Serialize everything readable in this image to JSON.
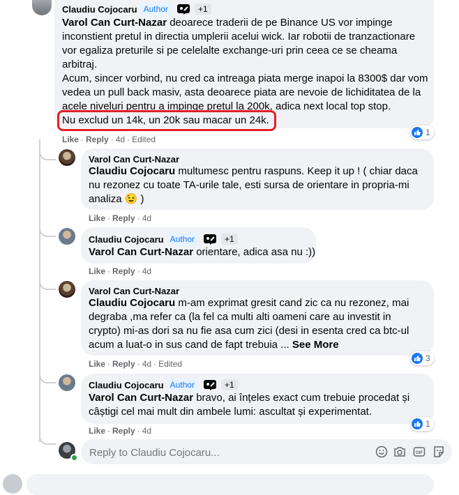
{
  "main_comment": {
    "author": "Claudiu Cojocaru",
    "author_badge": "Author",
    "plus_badge": "+1",
    "mention": "Varol Can Curt-Nazar",
    "p1_rest": " deoarece traderii de pe Binance US vor impinge inconstient pretul in directia umplerii acelui wick. Iar robotii de tranzactionare vor egaliza preturile si pe celelalte exchange-uri prin ceea ce se cheama arbitraj.",
    "p2": "Acum, sincer vorbind, nu cred ca intreaga piata merge inapoi la 8300$ dar vom vedea un pull back masiv, asta deoarece piata are nevoie de lichiditatea de la acele niveluri pentru a impinge pretul la 200k, adica next local top stop.",
    "p3": "Nu exclud un 14k, un 20k sau macar un 24k.",
    "like": "Like",
    "reply": "Reply",
    "time": "4d",
    "edited": "Edited",
    "reactions": "1"
  },
  "replies": [
    {
      "author": "Varol Can Curt-Nazar",
      "mention": "Claudiu Cojocaru",
      "text": " multumesc pentru raspuns. Keep it up ! ( chiar daca nu rezonez cu toate TA-urile tale, esti sursa de orientare in propria-mi analiza ",
      "emoji": "😉",
      "text_end": " )",
      "like": "Like",
      "reply": "Reply",
      "time": "4d"
    },
    {
      "author": "Claudiu Cojocaru",
      "author_badge": "Author",
      "plus_badge": "+1",
      "mention": "Varol Can Curt-Nazar",
      "text": " orientare, adica asa nu :))",
      "like": "Like",
      "reply": "Reply",
      "time": "4d"
    },
    {
      "author": "Varol Can Curt-Nazar",
      "mention": "Claudiu Cojocaru",
      "text": " m-am exprimat gresit cand zic ca nu rezonez, mai degraba ,ma refer ca (la fel ca multi alti oameni care au investit in crypto) mi-as dori sa nu fie asa cum zici (desi in esenta cred ca btc-ul acum a luat-o in sus cand de fapt trebuia ... ",
      "see_more": "See More",
      "like": "Like",
      "reply": "Reply",
      "time": "4d",
      "edited": "Edited",
      "reactions": "3"
    },
    {
      "author": "Claudiu Cojocaru",
      "author_badge": "Author",
      "plus_badge": "+1",
      "mention": "Varol Can Curt-Nazar",
      "text": " bravo, ai înțeles exact cum trebuie procedat și câștigi cel mai mult din ambele lumi: ascultat și experimentat.",
      "like": "Like",
      "reply": "Reply",
      "time": "4d",
      "reactions": "1"
    }
  ],
  "composer": {
    "placeholder": "Reply to Claudiu Cojocaru..."
  },
  "colors": {
    "bubble": "#f0f2f5",
    "accent": "#1877f2",
    "highlight_box": "#e41e26",
    "meta_text": "#65676b"
  }
}
